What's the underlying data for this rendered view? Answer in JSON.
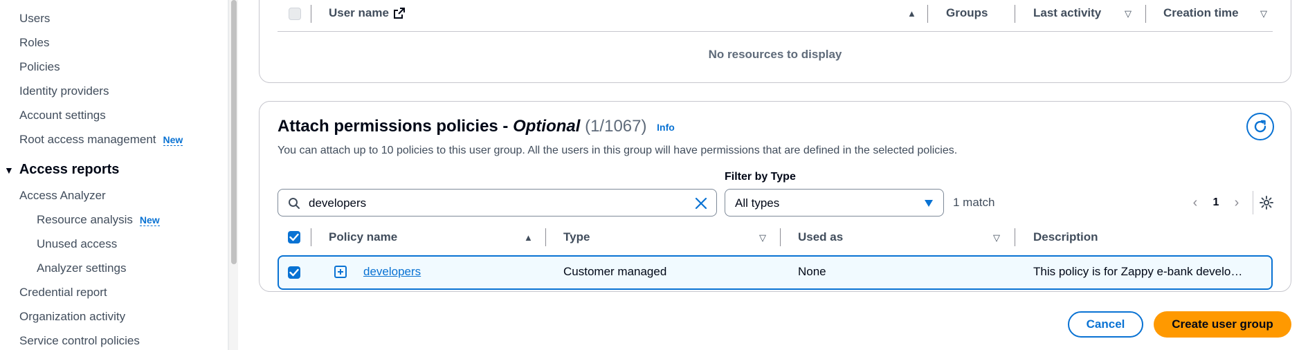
{
  "sidebar": {
    "items": [
      {
        "label": "Users"
      },
      {
        "label": "Roles"
      },
      {
        "label": "Policies"
      },
      {
        "label": "Identity providers"
      },
      {
        "label": "Account settings"
      },
      {
        "label": "Root access management",
        "badge": "New"
      }
    ],
    "section_access_reports": "Access reports",
    "access_items": [
      {
        "label": "Access Analyzer"
      },
      {
        "label": "Resource analysis",
        "badge": "New"
      },
      {
        "label": "Unused access"
      },
      {
        "label": "Analyzer settings"
      },
      {
        "label": "Credential report"
      },
      {
        "label": "Organization activity"
      },
      {
        "label": "Service control policies"
      }
    ]
  },
  "users_table": {
    "columns": [
      "User name",
      "Groups",
      "Last activity",
      "Creation time"
    ],
    "empty_text": "No resources to display"
  },
  "policies": {
    "title_main": "Attach permissions policies - ",
    "title_optional": "Optional",
    "title_count": "(1/1067)",
    "info_label": "Info",
    "description": "You can attach up to 10 policies to this user group. All the users in this group will have permissions that are defined in the selected policies.",
    "search_value": "developers",
    "filter_label": "Filter by Type",
    "filter_value": "All types",
    "match_text": "1 match",
    "page_number": "1",
    "columns": [
      "Policy name",
      "Type",
      "Used as",
      "Description"
    ],
    "rows": [
      {
        "name": "developers",
        "type": "Customer managed",
        "used_as": "None",
        "description": "This policy is for Zappy e-bank develo…"
      }
    ]
  },
  "actions": {
    "cancel_label": "Cancel",
    "create_label": "Create user group"
  },
  "colors": {
    "accent": "#0972d3",
    "primary_button": "#ff9900"
  }
}
